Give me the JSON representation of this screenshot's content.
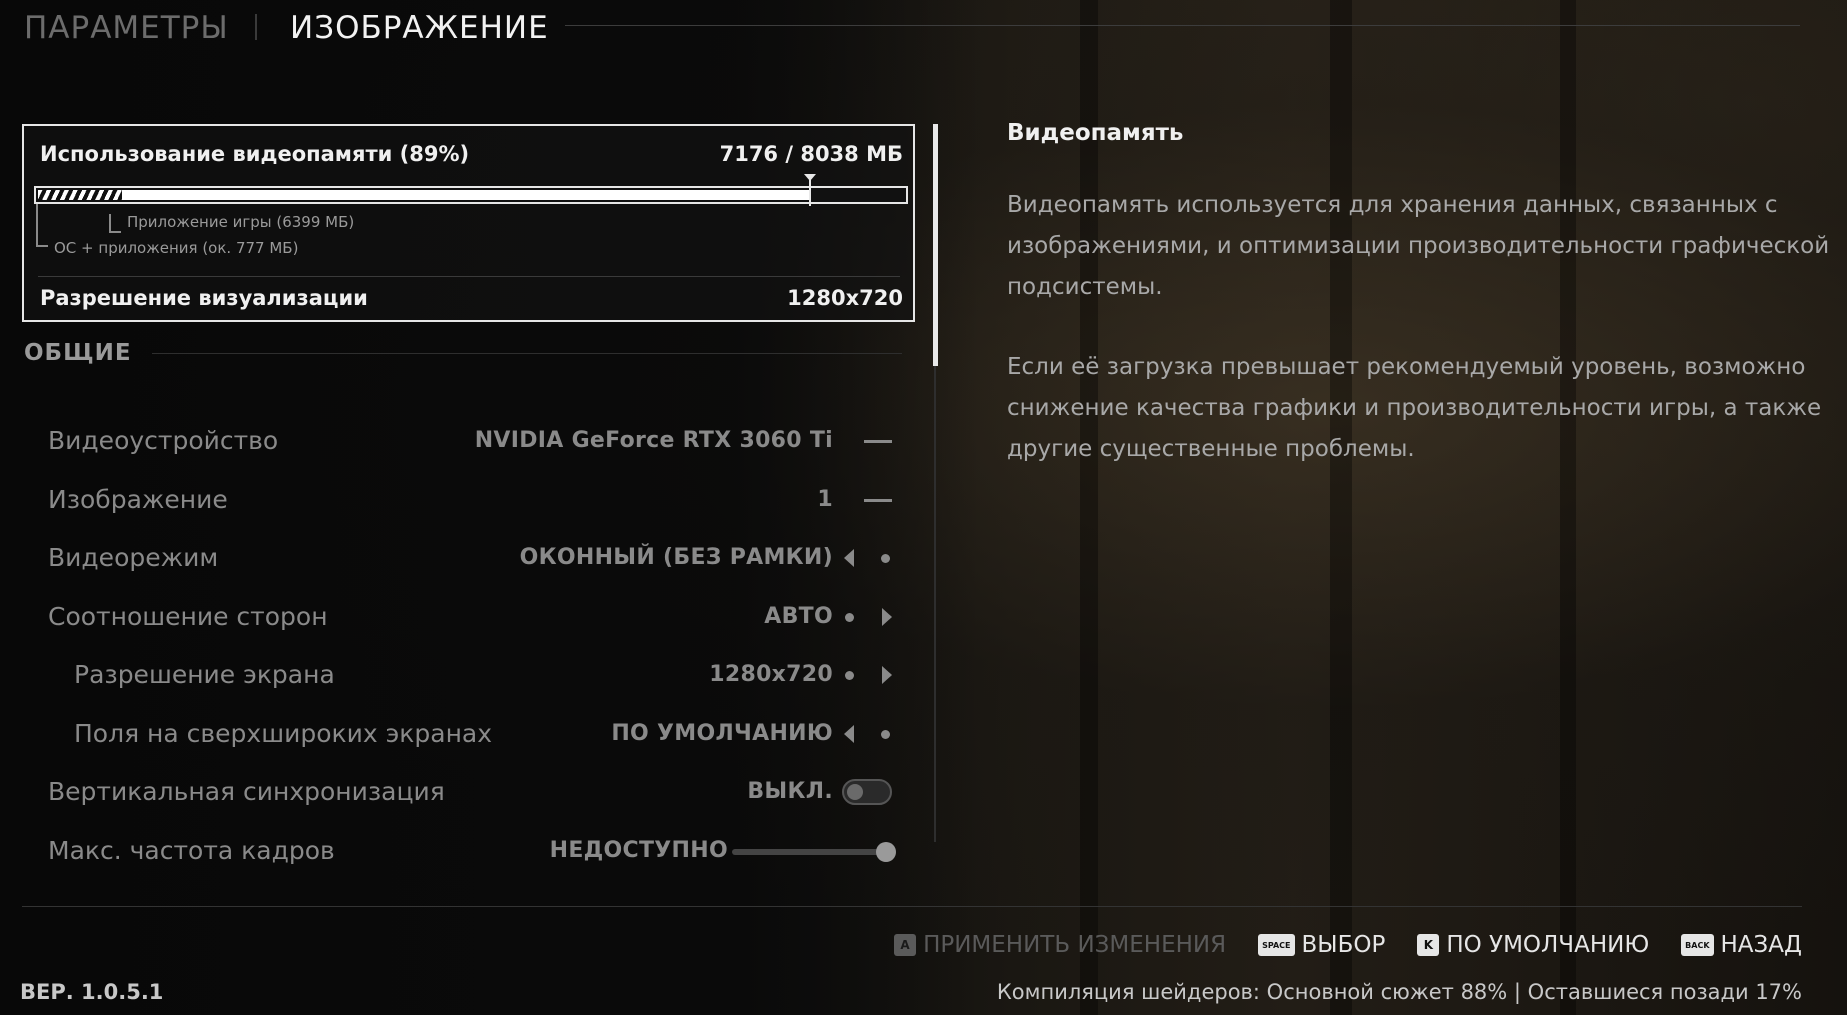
{
  "header": {
    "tab_params": "ПАРАМЕТРЫ",
    "tab_image": "ИЗОБРАЖЕНИЕ"
  },
  "vram": {
    "title": "Использование видеопамяти (89%)",
    "value": "7176 / 8038 МБ",
    "usage_fraction": 0.89,
    "os_label": "ОС + приложения (ок. 777 МБ)",
    "app_label": "Приложение игры (6399 МБ)",
    "resolution_label": "Разрешение визуализации",
    "resolution_value": "1280x720"
  },
  "section": {
    "title": "ОБЩИЕ"
  },
  "settings": [
    {
      "label": "Видеоустройство",
      "value": "NVIDIA GeForce RTX 3060 Ti",
      "control": "dash"
    },
    {
      "label": "Изображение",
      "value": "1",
      "control": "dash"
    },
    {
      "label": "Видеорежим",
      "value": "ОКОННЫЙ (БЕЗ РАМКИ)",
      "control": "left-arrow"
    },
    {
      "label": "Соотношение сторон",
      "value": "АВТО",
      "control": "right-arrow"
    },
    {
      "label": "Разрешение экрана",
      "value": "1280x720",
      "control": "right-arrow"
    },
    {
      "label": "Поля на сверхшироких экранах",
      "value": "ПО УМОЛЧАНИЮ",
      "control": "left-arrow"
    },
    {
      "label": "Вертикальная синхронизация",
      "value": "ВЫКЛ.",
      "control": "toggle",
      "enabled": false
    },
    {
      "label": "Макс. частота кадров",
      "value": "НЕДОСТУПНО",
      "control": "slider",
      "level": 1.0
    }
  ],
  "description": {
    "title": "Видеопамять",
    "paragraph1": "Видеопамять используется для хранения данных, связанных с изображениями, и оптимизации производительности графической подсистемы.",
    "paragraph2": "Если её загрузка превышает рекомендуемый уровень, возможно снижение качества графики и производительности игры, а также другие существенные проблемы."
  },
  "footer": {
    "actions": [
      {
        "key": "A",
        "label": "ПРИМЕНИТЬ ИЗМЕНЕНИЯ",
        "disabled": true
      },
      {
        "key": "SPACE",
        "label": "ВЫБОР",
        "disabled": false
      },
      {
        "key": "K",
        "label": "ПО УМОЛЧАНИЮ",
        "disabled": false
      },
      {
        "key": "BACK",
        "label": "НАЗАД",
        "disabled": false
      }
    ],
    "version": "ВЕР. 1.0.5.1",
    "shader_status": "Компиляция шейдеров: Основной сюжет 88% | Оставшиеся позади 17%"
  },
  "colors": {
    "accent": "#e6e6e6",
    "dim_text": "#8a8a8a",
    "background": "#0d0c0b"
  }
}
